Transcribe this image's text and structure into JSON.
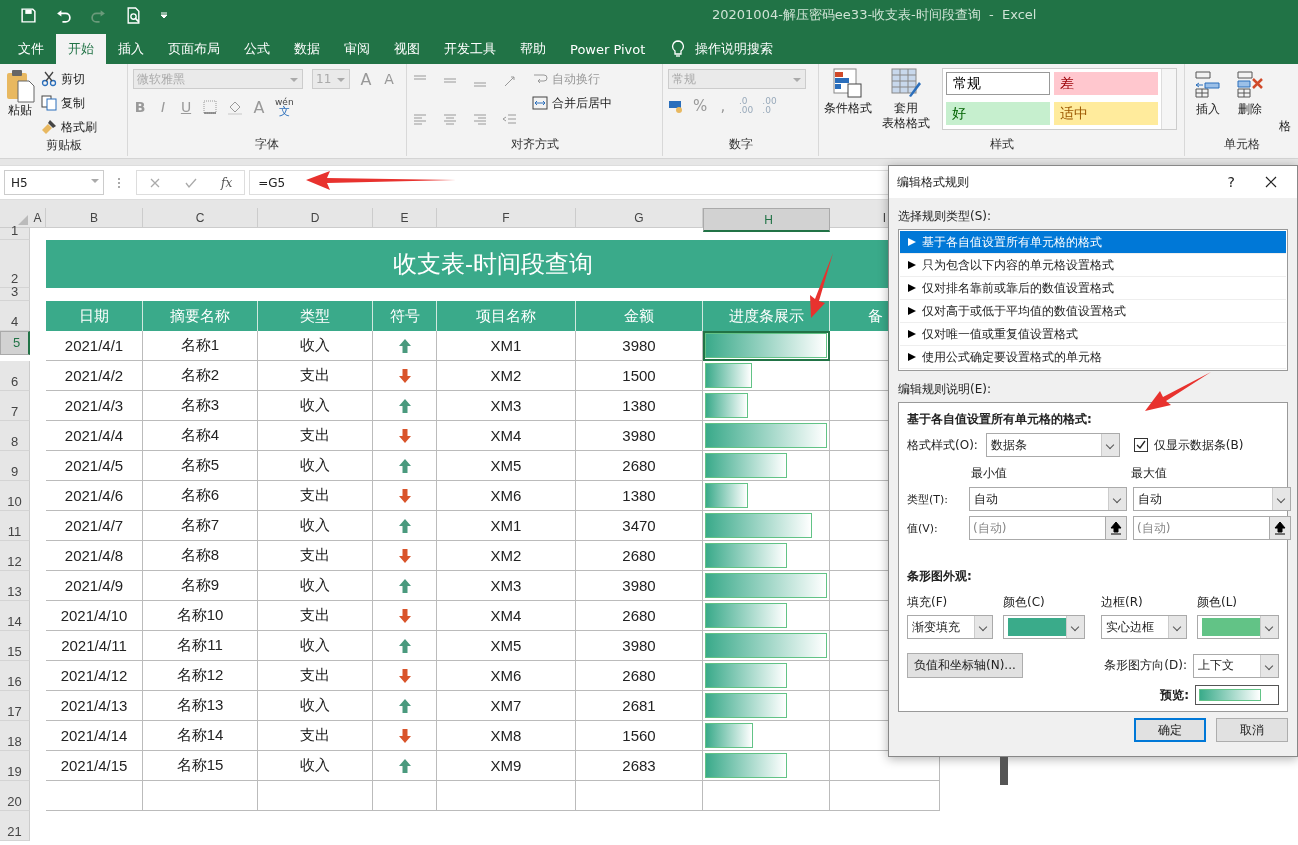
{
  "window": {
    "title": "20201004-解压密码ee33-收支表-时间段查询  -  Excel"
  },
  "tabs": [
    {
      "label": "文件",
      "selected": false
    },
    {
      "label": "开始",
      "selected": true
    },
    {
      "label": "插入",
      "selected": false
    },
    {
      "label": "页面布局",
      "selected": false
    },
    {
      "label": "公式",
      "selected": false
    },
    {
      "label": "数据",
      "selected": false
    },
    {
      "label": "审阅",
      "selected": false
    },
    {
      "label": "视图",
      "selected": false
    },
    {
      "label": "开发工具",
      "selected": false
    },
    {
      "label": "帮助",
      "selected": false
    },
    {
      "label": "Power Pivot",
      "selected": false
    }
  ],
  "tell_me": "操作说明搜索",
  "ribbon": {
    "clipboard": {
      "paste": "粘贴",
      "cut": "剪切",
      "copy": "复制",
      "format_painter": "格式刷",
      "label": "剪贴板"
    },
    "font": {
      "disabled": true,
      "name": "微软雅黑",
      "size": "11",
      "grow": "A",
      "shrink": "A",
      "bold": "B",
      "italic": "I",
      "underline": "U",
      "font_color": "A",
      "phonetic": "wén",
      "phonetic_char": "文",
      "label": "字体"
    },
    "alignment": {
      "disabled": true,
      "wrap": "自动换行",
      "merge": "合并后居中",
      "label": "对齐方式"
    },
    "number": {
      "disabled": true,
      "format": "常规",
      "percent": "%",
      "comma": ",",
      "increase_decimal": [
        ".0",
        ".00"
      ],
      "decrease_decimal": [
        ".00",
        ".0"
      ],
      "label": "数字"
    },
    "styles": {
      "conditional": "条件格式",
      "table_format": "套用",
      "table_format_2": "表格格式",
      "gallery": [
        {
          "label": "常规",
          "kind": "normal"
        },
        {
          "label": "差",
          "kind": "bad"
        },
        {
          "label": "好",
          "kind": "good"
        },
        {
          "label": "适中",
          "kind": "neutral"
        }
      ],
      "label": "样式"
    },
    "cells": {
      "insert": "插入",
      "delete": "删除",
      "format": "格",
      "label": "单元格"
    }
  },
  "formula_bar": {
    "name_box": "H5",
    "formula": "=G5",
    "fx": "fx"
  },
  "grid": {
    "columns": [
      {
        "label": "A",
        "selected": false
      },
      {
        "label": "B",
        "selected": false
      },
      {
        "label": "C",
        "selected": false
      },
      {
        "label": "D",
        "selected": false
      },
      {
        "label": "E",
        "selected": false
      },
      {
        "label": "F",
        "selected": false
      },
      {
        "label": "G",
        "selected": false
      },
      {
        "label": "H",
        "selected": true
      },
      {
        "label": "I",
        "selected": false
      }
    ],
    "row_numbers": [
      "1",
      "2",
      "3",
      "4",
      "5",
      "6",
      "7",
      "8",
      "9",
      "10",
      "11",
      "12",
      "13",
      "14",
      "15",
      "16",
      "17",
      "18",
      "19",
      "20",
      "21"
    ]
  },
  "sheet": {
    "title": "收支表-时间段查询",
    "headers": [
      "日期",
      "摘要名称",
      "类型",
      "符号",
      "项目名称",
      "金额",
      "进度条展示",
      "备"
    ],
    "rows": [
      {
        "date": "2021/4/1",
        "name": "名称1",
        "type": "收入",
        "kind": "up",
        "project": "XM1",
        "amount": "3980",
        "level": 1,
        "selected": true
      },
      {
        "date": "2021/4/2",
        "name": "名称2",
        "type": "支出",
        "kind": "down",
        "project": "XM2",
        "amount": "1500",
        "level": 0.38,
        "selected": false
      },
      {
        "date": "2021/4/3",
        "name": "名称3",
        "type": "收入",
        "kind": "up",
        "project": "XM3",
        "amount": "1380",
        "level": 0.35,
        "selected": false
      },
      {
        "date": "2021/4/4",
        "name": "名称4",
        "type": "支出",
        "kind": "down",
        "project": "XM4",
        "amount": "3980",
        "level": 1,
        "selected": false
      },
      {
        "date": "2021/4/5",
        "name": "名称5",
        "type": "收入",
        "kind": "up",
        "project": "XM5",
        "amount": "2680",
        "level": 0.67,
        "selected": false
      },
      {
        "date": "2021/4/6",
        "name": "名称6",
        "type": "支出",
        "kind": "down",
        "project": "XM6",
        "amount": "1380",
        "level": 0.35,
        "selected": false
      },
      {
        "date": "2021/4/7",
        "name": "名称7",
        "type": "收入",
        "kind": "up",
        "project": "XM1",
        "amount": "3470",
        "level": 0.87,
        "selected": false
      },
      {
        "date": "2021/4/8",
        "name": "名称8",
        "type": "支出",
        "kind": "down",
        "project": "XM2",
        "amount": "2680",
        "level": 0.67,
        "selected": false
      },
      {
        "date": "2021/4/9",
        "name": "名称9",
        "type": "收入",
        "kind": "up",
        "project": "XM3",
        "amount": "3980",
        "level": 1,
        "selected": false
      },
      {
        "date": "2021/4/10",
        "name": "名称10",
        "type": "支出",
        "kind": "down",
        "project": "XM4",
        "amount": "2680",
        "level": 0.67,
        "selected": false
      },
      {
        "date": "2021/4/11",
        "name": "名称11",
        "type": "收入",
        "kind": "up",
        "project": "XM5",
        "amount": "3980",
        "level": 1,
        "selected": false
      },
      {
        "date": "2021/4/12",
        "name": "名称12",
        "type": "支出",
        "kind": "down",
        "project": "XM6",
        "amount": "2680",
        "level": 0.67,
        "selected": false
      },
      {
        "date": "2021/4/13",
        "name": "名称13",
        "type": "收入",
        "kind": "up",
        "project": "XM7",
        "amount": "2681",
        "level": 0.67,
        "selected": false
      },
      {
        "date": "2021/4/14",
        "name": "名称14",
        "type": "支出",
        "kind": "down",
        "project": "XM8",
        "amount": "1560",
        "level": 0.39,
        "selected": false
      },
      {
        "date": "2021/4/15",
        "name": "名称15",
        "type": "收入",
        "kind": "up",
        "project": "XM9",
        "amount": "2683",
        "level": 0.67,
        "selected": false
      }
    ]
  },
  "dialog": {
    "title": "编辑格式规则",
    "help": "?",
    "rule_type_label": "选择规则类型(S):",
    "rule_types": [
      {
        "label": "基于各自值设置所有单元格的格式",
        "selected": true
      },
      {
        "label": "只为包含以下内容的单元格设置格式",
        "selected": false
      },
      {
        "label": "仅对排名靠前或靠后的数值设置格式",
        "selected": false
      },
      {
        "label": "仅对高于或低于平均值的数值设置格式",
        "selected": false
      },
      {
        "label": "仅对唯一值或重复值设置格式",
        "selected": false
      },
      {
        "label": "使用公式确定要设置格式的单元格",
        "selected": false
      }
    ],
    "description_label": "编辑规则说明(E):",
    "heading": "基于各自值设置所有单元格的格式:",
    "format_style_label": "格式样式(O):",
    "format_style": "数据条",
    "bar_only": {
      "label": "仅显示数据条(B)",
      "checked": true
    },
    "min_label": "最小值",
    "max_label": "最大值",
    "type_label": "类型(T):",
    "min_type": "自动",
    "max_type": "自动",
    "value_label": "值(V):",
    "min_value_placeholder": "(自动)",
    "max_value_placeholder": "(自动)",
    "appearance_heading": "条形图外观:",
    "fill_label": "填充(F)",
    "fill": "渐变填充",
    "fill_color_label": "颜色(C)",
    "fill_color": {
      "color": "#3aab8a"
    },
    "border_label": "边框(R)",
    "border": "实心边框",
    "border_color_label": "颜色(L)",
    "border_color": {
      "color": "#62c386"
    },
    "axis_button": "负值和坐标轴(N)...",
    "direction_label": "条形图方向(D):",
    "direction": "上下文",
    "preview_label": "预览:",
    "ok": "确定",
    "cancel": "取消"
  }
}
